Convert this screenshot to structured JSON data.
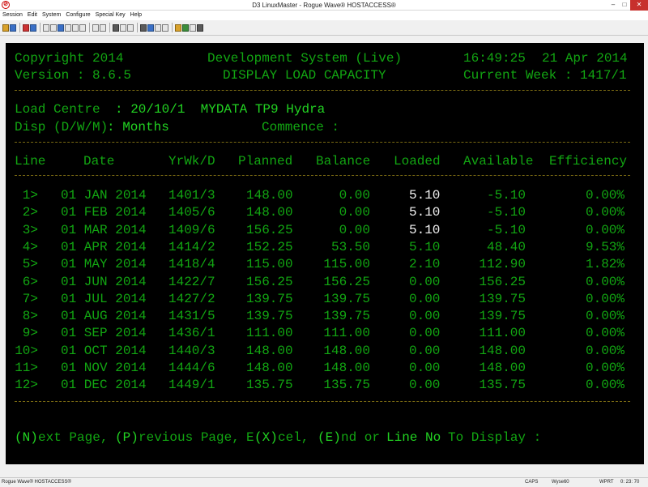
{
  "window": {
    "title": "D3 LinuxMaster - Rogue Wave® HOSTACCESS®"
  },
  "menu": [
    "Session",
    "Edit",
    "System",
    "Configure",
    "Special Key",
    "Help"
  ],
  "header": {
    "copyright": "Copyright 2014",
    "system": "Development System (Live)",
    "time": "16:49:25",
    "date": "21 Apr 2014",
    "version": "Version : 8.6.5",
    "screen_title": "DISPLAY LOAD CAPACITY",
    "current_week": "Current Week : 1417/1"
  },
  "info": {
    "load_centre_label": "Load Centre",
    "load_centre_value": ": 20/10/1  MYDATA TP9 Hydra",
    "disp_label": "Disp (D/W/M)",
    "disp_value": ": Months",
    "commence_label": "Commence :"
  },
  "table": {
    "columns": [
      "Line",
      "Date",
      "YrWk/D",
      "Planned",
      "Balance",
      "Loaded",
      "Available",
      "Efficiency"
    ],
    "rows": [
      {
        "line": "1>",
        "date": "01 JAN 2014",
        "yrwk": "1401/3",
        "planned": "148.00",
        "balance": "0.00",
        "loaded": "5.10",
        "available": "-5.10",
        "eff": "0.00%"
      },
      {
        "line": "2>",
        "date": "01 FEB 2014",
        "yrwk": "1405/6",
        "planned": "148.00",
        "balance": "0.00",
        "loaded": "5.10",
        "available": "-5.10",
        "eff": "0.00%"
      },
      {
        "line": "3>",
        "date": "01 MAR 2014",
        "yrwk": "1409/6",
        "planned": "156.25",
        "balance": "0.00",
        "loaded": "5.10",
        "available": "-5.10",
        "eff": "0.00%"
      },
      {
        "line": "4>",
        "date": "01 APR 2014",
        "yrwk": "1414/2",
        "planned": "152.25",
        "balance": "53.50",
        "loaded": "5.10",
        "available": "48.40",
        "eff": "9.53%"
      },
      {
        "line": "5>",
        "date": "01 MAY 2014",
        "yrwk": "1418/4",
        "planned": "115.00",
        "balance": "115.00",
        "loaded": "2.10",
        "available": "112.90",
        "eff": "1.82%"
      },
      {
        "line": "6>",
        "date": "01 JUN 2014",
        "yrwk": "1422/7",
        "planned": "156.25",
        "balance": "156.25",
        "loaded": "0.00",
        "available": "156.25",
        "eff": "0.00%"
      },
      {
        "line": "7>",
        "date": "01 JUL 2014",
        "yrwk": "1427/2",
        "planned": "139.75",
        "balance": "139.75",
        "loaded": "0.00",
        "available": "139.75",
        "eff": "0.00%"
      },
      {
        "line": "8>",
        "date": "01 AUG 2014",
        "yrwk": "1431/5",
        "planned": "139.75",
        "balance": "139.75",
        "loaded": "0.00",
        "available": "139.75",
        "eff": "0.00%"
      },
      {
        "line": "9>",
        "date": "01 SEP 2014",
        "yrwk": "1436/1",
        "planned": "111.00",
        "balance": "111.00",
        "loaded": "0.00",
        "available": "111.00",
        "eff": "0.00%"
      },
      {
        "line": "10>",
        "date": "01 OCT 2014",
        "yrwk": "1440/3",
        "planned": "148.00",
        "balance": "148.00",
        "loaded": "0.00",
        "available": "148.00",
        "eff": "0.00%"
      },
      {
        "line": "11>",
        "date": "01 NOV 2014",
        "yrwk": "1444/6",
        "planned": "148.00",
        "balance": "148.00",
        "loaded": "0.00",
        "available": "148.00",
        "eff": "0.00%"
      },
      {
        "line": "12>",
        "date": "01 DEC 2014",
        "yrwk": "1449/1",
        "planned": "135.75",
        "balance": "135.75",
        "loaded": "0.00",
        "available": "135.75",
        "eff": "0.00%"
      }
    ]
  },
  "prompt": {
    "n_key": "(N)",
    "n_text": "ext Page,",
    "p_key": "(P)",
    "p_text": "revious Page,",
    "x_pre": "E",
    "x_key": "(X)",
    "x_text": "cel,",
    "e_key": "(E)",
    "e_text": "nd or",
    "line_no": "Line No",
    "to_display": "To Display :"
  },
  "status": {
    "app": "Rogue Wave® HOSTACCESS®",
    "caps": "CAPS",
    "emulation": "Wyse60",
    "mode": "WPRT",
    "cursor": "0: 23: 70"
  },
  "colors": {
    "terminal_bg": "#000000",
    "terminal_text": "#12a612",
    "highlight_text": "#22d322",
    "white_text": "#f2f2f2",
    "dash_line": "#7a6a12"
  }
}
